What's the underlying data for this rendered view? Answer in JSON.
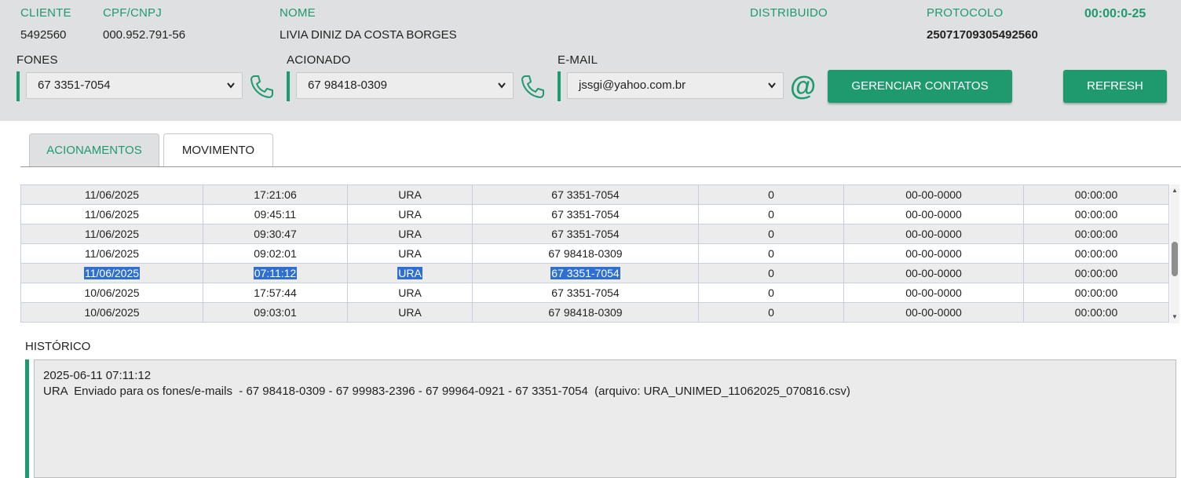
{
  "header": {
    "cliente": {
      "label": "CLIENTE",
      "value": "5492560"
    },
    "cpf": {
      "label": "CPF/CNPJ",
      "value": "000.952.791-56"
    },
    "nome": {
      "label": "NOME",
      "value": "LIVIA DINIZ DA COSTA BORGES"
    },
    "distribuido": {
      "label": "DISTRIBUIDO",
      "value": ""
    },
    "protocolo": {
      "label": "PROTOCOLO",
      "value": "25071709305492560"
    },
    "timer": "00:00:0-25"
  },
  "contacts": {
    "fones": {
      "label": "FONES",
      "selected": "67 3351-7054"
    },
    "acionado": {
      "label": "ACIONADO",
      "selected": "67 98418-0309"
    },
    "email": {
      "label": "E-MAIL",
      "selected": "jssgi@yahoo.com.br"
    },
    "gerenciar_label": "GERENCIAR CONTATOS",
    "refresh_label": "REFRESH"
  },
  "tabs": [
    {
      "label": "ACIONAMENTOS",
      "active": true
    },
    {
      "label": "MOVIMENTO",
      "active": false
    }
  ],
  "grid": {
    "rows": [
      {
        "data": "11/06/2025",
        "hora": "17:21:06",
        "tipo": "URA",
        "fone": "67 3351-7054",
        "qtd": "0",
        "data2": "00-00-0000",
        "tempo": "00:00:00",
        "selected": false
      },
      {
        "data": "11/06/2025",
        "hora": "09:45:11",
        "tipo": "URA",
        "fone": "67 3351-7054",
        "qtd": "0",
        "data2": "00-00-0000",
        "tempo": "00:00:00",
        "selected": false
      },
      {
        "data": "11/06/2025",
        "hora": "09:30:47",
        "tipo": "URA",
        "fone": "67 3351-7054",
        "qtd": "0",
        "data2": "00-00-0000",
        "tempo": "00:00:00",
        "selected": false
      },
      {
        "data": "11/06/2025",
        "hora": "09:02:01",
        "tipo": "URA",
        "fone": "67 98418-0309",
        "qtd": "0",
        "data2": "00-00-0000",
        "tempo": "00:00:00",
        "selected": false
      },
      {
        "data": "11/06/2025",
        "hora": "07:11:12",
        "tipo": "URA",
        "fone": "67 3351-7054",
        "qtd": "0",
        "data2": "00-00-0000",
        "tempo": "00:00:00",
        "selected": true
      },
      {
        "data": "10/06/2025",
        "hora": "17:57:44",
        "tipo": "URA",
        "fone": "67 3351-7054",
        "qtd": "0",
        "data2": "00-00-0000",
        "tempo": "00:00:00",
        "selected": false
      },
      {
        "data": "10/06/2025",
        "hora": "09:03:01",
        "tipo": "URA",
        "fone": "67 98418-0309",
        "qtd": "0",
        "data2": "00-00-0000",
        "tempo": "00:00:00",
        "selected": false
      }
    ]
  },
  "historico": {
    "label": "HISTÓRICO",
    "line1": "2025-06-11 07:11:12",
    "line2": "URA  Enviado para os fones/e-mails  - 67 98418-0309 - 67 99983-2396 - 67 99964-0921 - 67 3351-7054  (arquivo: URA_UNIMED_11062025_070816.csv)"
  },
  "icons": {
    "phone": "phone-icon",
    "email": "at-icon",
    "dropdown": "chevron-down-icon"
  },
  "colors": {
    "accent": "#1f9a6f",
    "header_bg": "#dfe0e1",
    "selection": "#2f6fd0"
  }
}
